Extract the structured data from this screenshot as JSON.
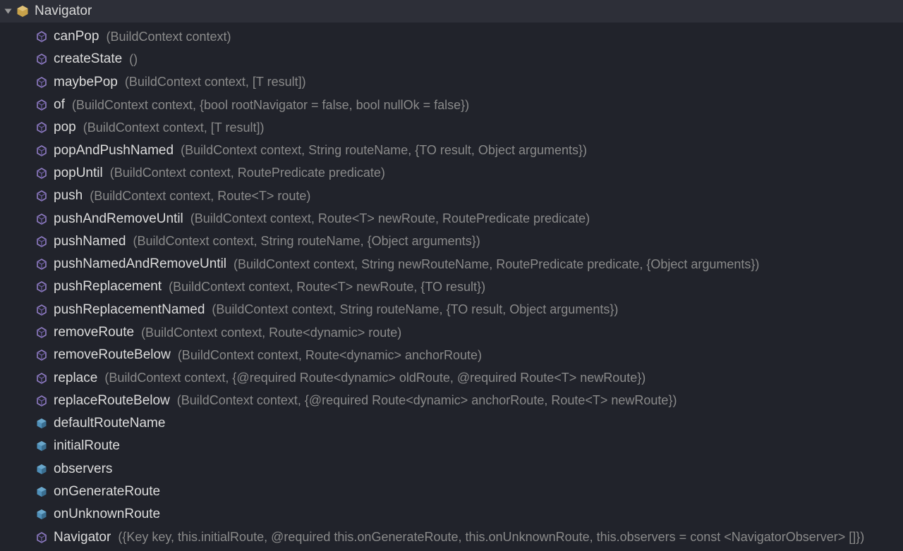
{
  "header": {
    "title": "Navigator"
  },
  "members": [
    {
      "kind": "method",
      "name": "canPop",
      "params": "(BuildContext context)"
    },
    {
      "kind": "method",
      "name": "createState",
      "params": "()"
    },
    {
      "kind": "method",
      "name": "maybePop",
      "params": "(BuildContext context, [T result])"
    },
    {
      "kind": "method",
      "name": "of",
      "params": "(BuildContext context, {bool rootNavigator = false, bool nullOk = false})"
    },
    {
      "kind": "method",
      "name": "pop",
      "params": "(BuildContext context, [T result])"
    },
    {
      "kind": "method",
      "name": "popAndPushNamed",
      "params": "(BuildContext context, String routeName, {TO result, Object arguments})"
    },
    {
      "kind": "method",
      "name": "popUntil",
      "params": "(BuildContext context, RoutePredicate predicate)"
    },
    {
      "kind": "method",
      "name": "push",
      "params": "(BuildContext context, Route<T> route)"
    },
    {
      "kind": "method",
      "name": "pushAndRemoveUntil",
      "params": "(BuildContext context, Route<T> newRoute, RoutePredicate predicate)"
    },
    {
      "kind": "method",
      "name": "pushNamed",
      "params": "(BuildContext context, String routeName, {Object arguments})"
    },
    {
      "kind": "method",
      "name": "pushNamedAndRemoveUntil",
      "params": "(BuildContext context, String newRouteName, RoutePredicate predicate, {Object arguments})"
    },
    {
      "kind": "method",
      "name": "pushReplacement",
      "params": "(BuildContext context, Route<T> newRoute, {TO result})"
    },
    {
      "kind": "method",
      "name": "pushReplacementNamed",
      "params": "(BuildContext context, String routeName, {TO result, Object arguments})"
    },
    {
      "kind": "method",
      "name": "removeRoute",
      "params": "(BuildContext context, Route<dynamic> route)"
    },
    {
      "kind": "method",
      "name": "removeRouteBelow",
      "params": "(BuildContext context, Route<dynamic> anchorRoute)"
    },
    {
      "kind": "method",
      "name": "replace",
      "params": "(BuildContext context, {@required Route<dynamic> oldRoute, @required Route<T> newRoute})"
    },
    {
      "kind": "method",
      "name": "replaceRouteBelow",
      "params": "(BuildContext context, {@required Route<dynamic> anchorRoute, Route<T> newRoute})"
    },
    {
      "kind": "field",
      "name": "defaultRouteName",
      "params": ""
    },
    {
      "kind": "field",
      "name": "initialRoute",
      "params": ""
    },
    {
      "kind": "field",
      "name": "observers",
      "params": ""
    },
    {
      "kind": "field",
      "name": "onGenerateRoute",
      "params": ""
    },
    {
      "kind": "field",
      "name": "onUnknownRoute",
      "params": ""
    },
    {
      "kind": "method",
      "name": "Navigator",
      "params": "({Key key, this.initialRoute, @required this.onGenerateRoute, this.onUnknownRoute, this.observers = const <NavigatorObserver> []})"
    }
  ],
  "icons": {
    "method_color": "#8f7cc4",
    "method_stroke": "#6d5da0",
    "field_color": "#4f8fb8",
    "field_stroke": "#3a6e90",
    "class_bg": "#c8a24a",
    "class_accent": "#e0c178"
  }
}
